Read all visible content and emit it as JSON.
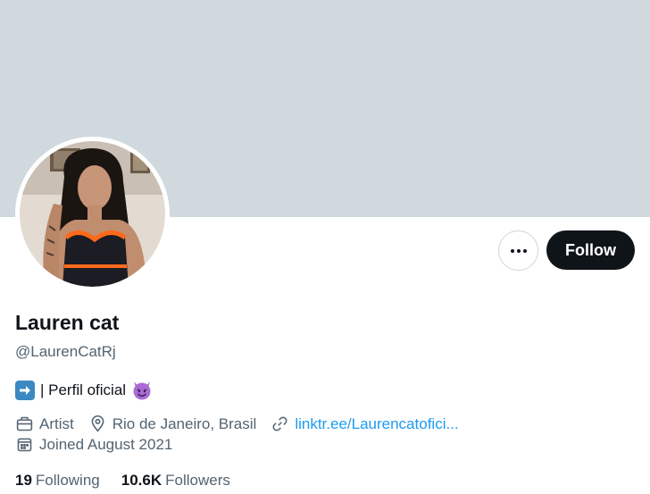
{
  "profile": {
    "display_name": "Lauren cat",
    "handle": "@LaurenCatRj",
    "bio_text": "| Perfil oficial",
    "occupation": "Artist",
    "location": "Rio de Janeiro, Brasil",
    "link": "linktr.ee/Laurencatofici...",
    "joined": "Joined August 2021"
  },
  "actions": {
    "follow_label": "Follow"
  },
  "stats": {
    "following_count": "19",
    "following_label": "Following",
    "followers_count": "10.6K",
    "followers_label": "Followers"
  },
  "colors": {
    "banner": "#cfd9de",
    "text_primary": "#0f1419",
    "text_secondary": "#536471",
    "link": "#1d9bf0",
    "follow_bg": "#0f1419"
  },
  "icons": {
    "bio_arrow": "right-arrow-emoji-icon",
    "bio_devil": "smiling-devil-emoji-icon",
    "occupation": "briefcase-icon",
    "location": "map-pin-icon",
    "link": "link-icon",
    "joined": "calendar-icon",
    "more": "more-dots-icon"
  }
}
